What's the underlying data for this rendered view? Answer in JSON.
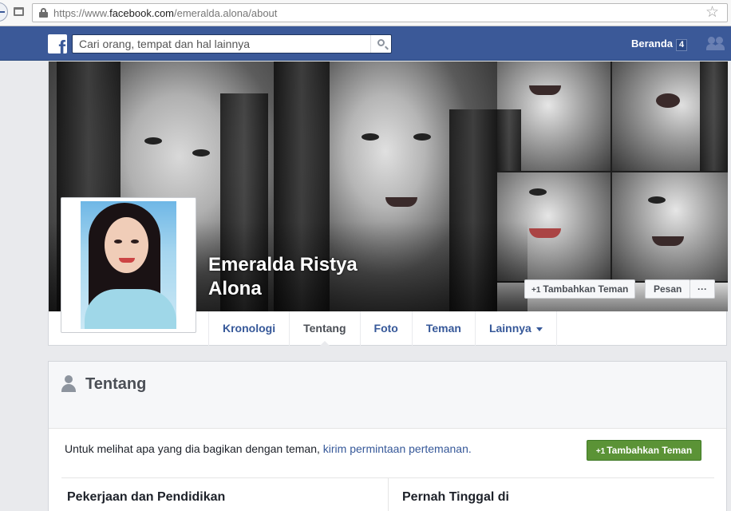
{
  "browser": {
    "url_prefix": "https://www.",
    "url_domain": "facebook.com",
    "url_path": "/emeralda.alona/about"
  },
  "topbar": {
    "search_placeholder": "Cari orang, tempat dan hal lainnya",
    "home_label": "Beranda",
    "home_count": "4"
  },
  "profile": {
    "name_line1": "Emeralda Ristya",
    "name_line2": "Alona",
    "add_friend_label": "Tambahkan Teman",
    "message_label": "Pesan",
    "more_label": "···"
  },
  "tabs": [
    {
      "label": "Kronologi"
    },
    {
      "label": "Tentang"
    },
    {
      "label": "Foto"
    },
    {
      "label": "Teman"
    },
    {
      "label": "Lainnya"
    }
  ],
  "about": {
    "title": "Tentang",
    "notice_text": "Untuk melihat apa yang dia bagikan dengan teman, ",
    "notice_link": "kirim permintaan pertemanan.",
    "add_friend_label": "Tambahkan Teman",
    "col1_title": "Pekerjaan dan Pendidikan",
    "col2_title": "Pernah Tinggal di"
  },
  "icons": {
    "plus": "+1",
    "search": "search-icon",
    "friends": "friends-icon",
    "person": "person-icon"
  },
  "colors": {
    "brand": "#3b5998",
    "link": "#365899",
    "green_button": "#5b9336"
  }
}
